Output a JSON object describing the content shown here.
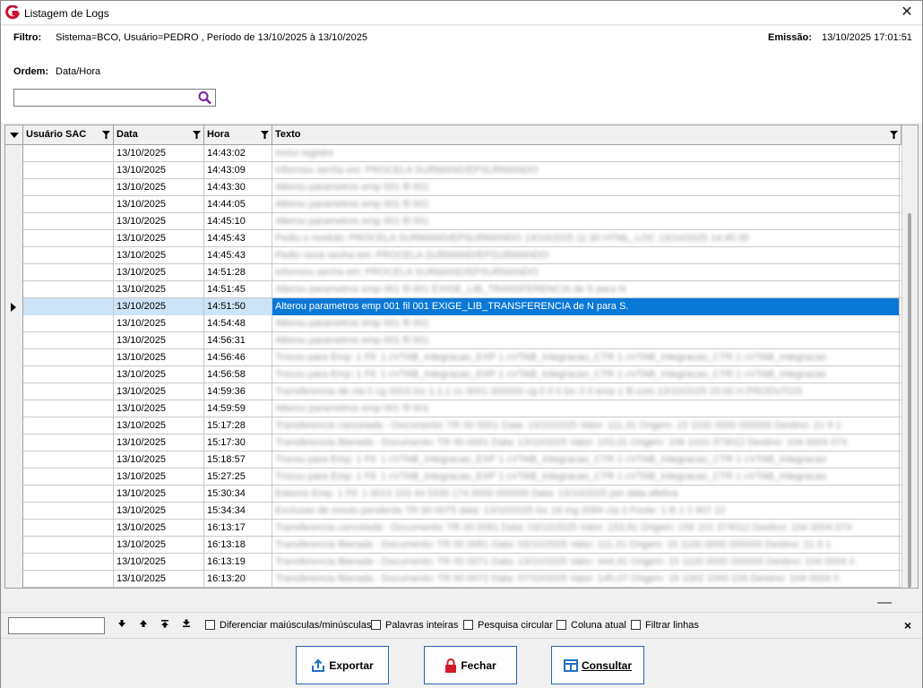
{
  "window": {
    "title": "Listagem de Logs"
  },
  "header": {
    "filtro_label": "Filtro:",
    "filtro_value": "Sistema=BCO, Usuário=PEDRO , Período de 13/10/2025 à 13/10/2025",
    "emissao_label": "Emissão:",
    "emissao_value": "13/10/2025 17:01:51",
    "ordem_label": "Ordem:",
    "ordem_value": "Data/Hora",
    "search_value": ""
  },
  "grid": {
    "columns": [
      "Usuário SAC",
      "Data",
      "Hora",
      "Texto"
    ],
    "rows": [
      {
        "usuario": "",
        "data": "13/10/2025",
        "hora": "14:43:02",
        "texto": "Inclui registro",
        "blur": true
      },
      {
        "usuario": "",
        "data": "13/10/2025",
        "hora": "14:43:09",
        "texto": "Informou senha em: PROCELA SURMAND/EPSURMANDO",
        "blur": true
      },
      {
        "usuario": "",
        "data": "13/10/2025",
        "hora": "14:43:30",
        "texto": "Alterou parametros emp 001 fil 001",
        "blur": true
      },
      {
        "usuario": "",
        "data": "13/10/2025",
        "hora": "14:44:05",
        "texto": "Alterou parametros emp 001 fil 001",
        "blur": true
      },
      {
        "usuario": "",
        "data": "13/10/2025",
        "hora": "14:45:10",
        "texto": "Alterou parametros emp 001 fil 001",
        "blur": true
      },
      {
        "usuario": "",
        "data": "13/10/2025",
        "hora": "14:45:43",
        "texto": "Pediu o modulo: PROCELA SURMAND/EPSURMANDO 13/10/2025 11:30 HTML_LOC 13/10/2025 14:45:35",
        "blur": true
      },
      {
        "usuario": "",
        "data": "13/10/2025",
        "hora": "14:45:43",
        "texto": "Pediu nova senha em: PROCELA SURMAND/EPSURMANDO",
        "blur": true
      },
      {
        "usuario": "",
        "data": "13/10/2025",
        "hora": "14:51:28",
        "texto": "Informou senha em: PROCELA SURMAND/EPSURMANDO",
        "blur": true
      },
      {
        "usuario": "",
        "data": "13/10/2025",
        "hora": "14:51:45",
        "texto": "Alterou parametros emp 001 fil 001 EXIGE_LIB_TRANSFERENCIA de S para N",
        "blur": true
      },
      {
        "usuario": "",
        "data": "13/10/2025",
        "hora": "14:51:50",
        "texto": "Alterou parametros emp 001 fil 001 EXIGE_LIB_TRANSFERENCIA de N para S.",
        "blur": false,
        "selected": true
      },
      {
        "usuario": "",
        "data": "13/10/2025",
        "hora": "14:54:48",
        "texto": "Alterou parametros emp 001 fil 001",
        "blur": true
      },
      {
        "usuario": "",
        "data": "13/10/2025",
        "hora": "14:56:31",
        "texto": "Alterou parametros emp 001 fil 001",
        "blur": true
      },
      {
        "usuario": "",
        "data": "13/10/2025",
        "hora": "14:56:46",
        "texto": "Trocou para Emp: 1 Fil: 1 cVTAB_Integracao_EXP 1 cVTAB_Integracao_CTR 1 cVTAB_Integracao_CTR 1 cVTAB_Integracao",
        "blur": true
      },
      {
        "usuario": "",
        "data": "13/10/2025",
        "hora": "14:56:58",
        "texto": "Trocou para Emp: 1 Fil: 1 cVTAB_Integracao_EXP 1 cVTAB_Integracao_CTR 1 cVTAB_Integracao_CTR 1 cVTAB_Integracao",
        "blur": true
      },
      {
        "usuario": "",
        "data": "13/10/2025",
        "hora": "14:59:36",
        "texto": "Transferencia de cta 0 cg 0003 loc 1.1.1 cc 0001 000000 cg 0 0 0 loc 0 0 emp 1 fil com 13/10/2025 15:00 H PRODUTOS",
        "blur": true
      },
      {
        "usuario": "",
        "data": "13/10/2025",
        "hora": "14:59:59",
        "texto": "Alterou parametros emp 001 fil 001",
        "blur": true
      },
      {
        "usuario": "",
        "data": "13/10/2025",
        "hora": "15:17:28",
        "texto": "Transferencia cancelada - Documento: TR 00 0001 Data: 13/10/2025 Valor: 111,31 Origem: 15 1100 0000 000000 Destino: 21 9 1",
        "blur": true
      },
      {
        "usuario": "",
        "data": "13/10/2025",
        "hora": "15:17:30",
        "texto": "Transferencia liberada - Documento: TR 00 0001 Data: 13/10/2025 Valor: 153,01 Origem: 156 1010 373012 Destino: 104 0004 074",
        "blur": true
      },
      {
        "usuario": "",
        "data": "13/10/2025",
        "hora": "15:18:57",
        "texto": "Trocou para Emp: 1 Fil: 1 cVTAB_Integracao_EXP 1 cVTAB_Integracao_CTR 1 cVTAB_Integracao_CTR 1 cVTAB_Integracao",
        "blur": true
      },
      {
        "usuario": "",
        "data": "13/10/2025",
        "hora": "15:27:25",
        "texto": "Trocou para Emp: 1 Fil: 1 cVTAB_Integracao_EXP 1 cVTAB_Integracao_CTR 1 cVTAB_Integracao_CTR 1 cVTAB_Integracao",
        "blur": true
      },
      {
        "usuario": "",
        "data": "13/10/2025",
        "hora": "15:30:34",
        "texto": "Estorno Emp: 1 Fil: 1 0013 153 44 5330 174 0000 000000 Data: 13/10/2025 por data efetiva",
        "blur": true
      },
      {
        "usuario": "",
        "data": "13/10/2025",
        "hora": "15:34:34",
        "texto": "Exclusao de movto pendente TR 00 0075 data: 13/10/2025 loc 18 mg 2084 cta 0 Fonte: 1 R 1 2 907 22",
        "blur": true
      },
      {
        "usuario": "",
        "data": "13/10/2025",
        "hora": "16:13:17",
        "texto": "Transferencia cancelada - Documento: TR 00 0081 Data: 03/10/2025 Valor: 153,91 Origem: 156 101 374012 Destino: 104 0004 074",
        "blur": true
      },
      {
        "usuario": "",
        "data": "13/10/2025",
        "hora": "16:13:18",
        "texto": "Transferencia liberada - Documento: TR 00 0081 Data: 03/10/2025 Valor: 111,31 Origem: 15 1100 0000 000000 Destino: 21 9 1",
        "blur": true
      },
      {
        "usuario": "",
        "data": "13/10/2025",
        "hora": "16:13:19",
        "texto": "Transferencia liberada - Documento: TR 00 0071 Data: 13/10/2025 Valor: 444,91 Origem: 15 1100 0000 000000 Destino: 104 0004 0",
        "blur": true
      },
      {
        "usuario": "",
        "data": "13/10/2025",
        "hora": "16:13:20",
        "texto": "Transferencia liberada - Documento: TR 00 0072 Data: 07/10/2025 Valor: 145,07 Origem: 15 1002 1000 226 Destino: 104 0004 0",
        "blur": true
      }
    ]
  },
  "findbar": {
    "value": "",
    "options": [
      "Diferenciar maiúsculas/minúsculas",
      "Palavras inteiras",
      "Pesquisa circular",
      "Coluna atual",
      "Filtrar linhas"
    ]
  },
  "footer": {
    "exportar": "Exportar",
    "fechar": "Fechar",
    "consultar": "Consultar"
  },
  "colors": {
    "selection": "#0a78d7",
    "selection_light": "#cde3f7",
    "button_border": "#2a63b0",
    "logo": "#c8102e",
    "search_icon": "#7a1fa2"
  }
}
